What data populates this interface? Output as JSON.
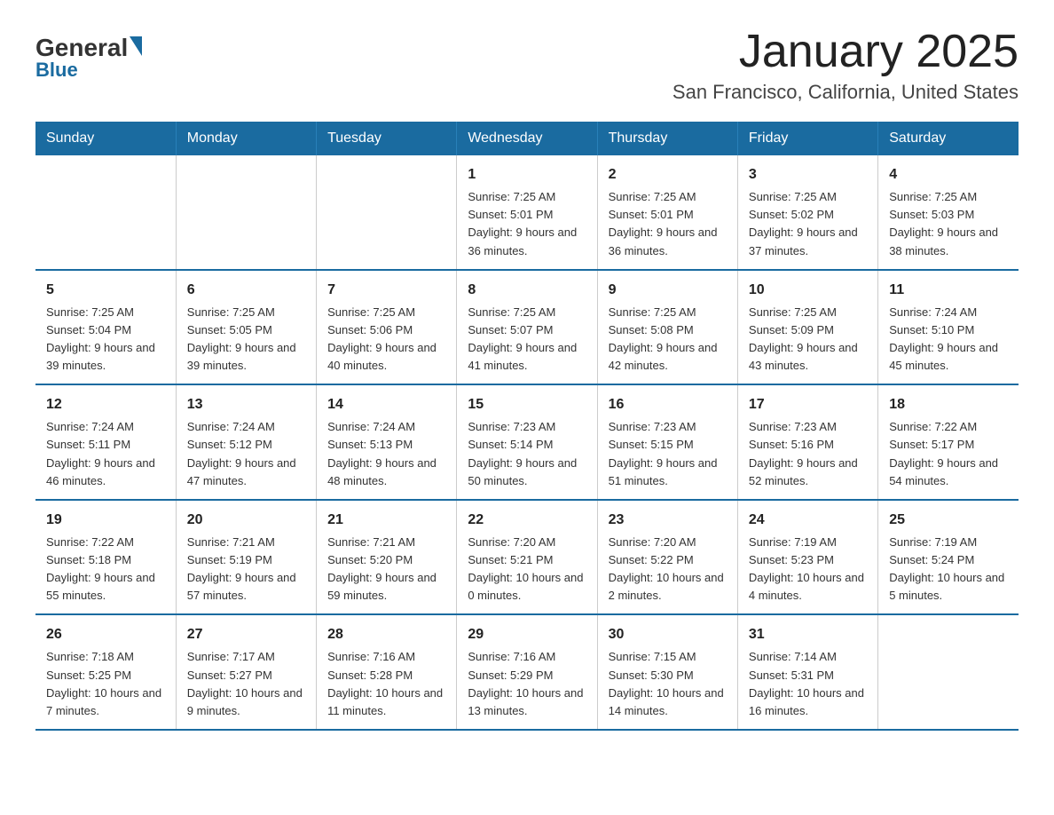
{
  "header": {
    "logo_general": "General",
    "logo_blue": "Blue",
    "month_title": "January 2025",
    "location": "San Francisco, California, United States"
  },
  "days_of_week": [
    "Sunday",
    "Monday",
    "Tuesday",
    "Wednesday",
    "Thursday",
    "Friday",
    "Saturday"
  ],
  "weeks": [
    [
      {
        "day": "",
        "sunrise": "",
        "sunset": "",
        "daylight": ""
      },
      {
        "day": "",
        "sunrise": "",
        "sunset": "",
        "daylight": ""
      },
      {
        "day": "",
        "sunrise": "",
        "sunset": "",
        "daylight": ""
      },
      {
        "day": "1",
        "sunrise": "Sunrise: 7:25 AM",
        "sunset": "Sunset: 5:01 PM",
        "daylight": "Daylight: 9 hours and 36 minutes."
      },
      {
        "day": "2",
        "sunrise": "Sunrise: 7:25 AM",
        "sunset": "Sunset: 5:01 PM",
        "daylight": "Daylight: 9 hours and 36 minutes."
      },
      {
        "day": "3",
        "sunrise": "Sunrise: 7:25 AM",
        "sunset": "Sunset: 5:02 PM",
        "daylight": "Daylight: 9 hours and 37 minutes."
      },
      {
        "day": "4",
        "sunrise": "Sunrise: 7:25 AM",
        "sunset": "Sunset: 5:03 PM",
        "daylight": "Daylight: 9 hours and 38 minutes."
      }
    ],
    [
      {
        "day": "5",
        "sunrise": "Sunrise: 7:25 AM",
        "sunset": "Sunset: 5:04 PM",
        "daylight": "Daylight: 9 hours and 39 minutes."
      },
      {
        "day": "6",
        "sunrise": "Sunrise: 7:25 AM",
        "sunset": "Sunset: 5:05 PM",
        "daylight": "Daylight: 9 hours and 39 minutes."
      },
      {
        "day": "7",
        "sunrise": "Sunrise: 7:25 AM",
        "sunset": "Sunset: 5:06 PM",
        "daylight": "Daylight: 9 hours and 40 minutes."
      },
      {
        "day": "8",
        "sunrise": "Sunrise: 7:25 AM",
        "sunset": "Sunset: 5:07 PM",
        "daylight": "Daylight: 9 hours and 41 minutes."
      },
      {
        "day": "9",
        "sunrise": "Sunrise: 7:25 AM",
        "sunset": "Sunset: 5:08 PM",
        "daylight": "Daylight: 9 hours and 42 minutes."
      },
      {
        "day": "10",
        "sunrise": "Sunrise: 7:25 AM",
        "sunset": "Sunset: 5:09 PM",
        "daylight": "Daylight: 9 hours and 43 minutes."
      },
      {
        "day": "11",
        "sunrise": "Sunrise: 7:24 AM",
        "sunset": "Sunset: 5:10 PM",
        "daylight": "Daylight: 9 hours and 45 minutes."
      }
    ],
    [
      {
        "day": "12",
        "sunrise": "Sunrise: 7:24 AM",
        "sunset": "Sunset: 5:11 PM",
        "daylight": "Daylight: 9 hours and 46 minutes."
      },
      {
        "day": "13",
        "sunrise": "Sunrise: 7:24 AM",
        "sunset": "Sunset: 5:12 PM",
        "daylight": "Daylight: 9 hours and 47 minutes."
      },
      {
        "day": "14",
        "sunrise": "Sunrise: 7:24 AM",
        "sunset": "Sunset: 5:13 PM",
        "daylight": "Daylight: 9 hours and 48 minutes."
      },
      {
        "day": "15",
        "sunrise": "Sunrise: 7:23 AM",
        "sunset": "Sunset: 5:14 PM",
        "daylight": "Daylight: 9 hours and 50 minutes."
      },
      {
        "day": "16",
        "sunrise": "Sunrise: 7:23 AM",
        "sunset": "Sunset: 5:15 PM",
        "daylight": "Daylight: 9 hours and 51 minutes."
      },
      {
        "day": "17",
        "sunrise": "Sunrise: 7:23 AM",
        "sunset": "Sunset: 5:16 PM",
        "daylight": "Daylight: 9 hours and 52 minutes."
      },
      {
        "day": "18",
        "sunrise": "Sunrise: 7:22 AM",
        "sunset": "Sunset: 5:17 PM",
        "daylight": "Daylight: 9 hours and 54 minutes."
      }
    ],
    [
      {
        "day": "19",
        "sunrise": "Sunrise: 7:22 AM",
        "sunset": "Sunset: 5:18 PM",
        "daylight": "Daylight: 9 hours and 55 minutes."
      },
      {
        "day": "20",
        "sunrise": "Sunrise: 7:21 AM",
        "sunset": "Sunset: 5:19 PM",
        "daylight": "Daylight: 9 hours and 57 minutes."
      },
      {
        "day": "21",
        "sunrise": "Sunrise: 7:21 AM",
        "sunset": "Sunset: 5:20 PM",
        "daylight": "Daylight: 9 hours and 59 minutes."
      },
      {
        "day": "22",
        "sunrise": "Sunrise: 7:20 AM",
        "sunset": "Sunset: 5:21 PM",
        "daylight": "Daylight: 10 hours and 0 minutes."
      },
      {
        "day": "23",
        "sunrise": "Sunrise: 7:20 AM",
        "sunset": "Sunset: 5:22 PM",
        "daylight": "Daylight: 10 hours and 2 minutes."
      },
      {
        "day": "24",
        "sunrise": "Sunrise: 7:19 AM",
        "sunset": "Sunset: 5:23 PM",
        "daylight": "Daylight: 10 hours and 4 minutes."
      },
      {
        "day": "25",
        "sunrise": "Sunrise: 7:19 AM",
        "sunset": "Sunset: 5:24 PM",
        "daylight": "Daylight: 10 hours and 5 minutes."
      }
    ],
    [
      {
        "day": "26",
        "sunrise": "Sunrise: 7:18 AM",
        "sunset": "Sunset: 5:25 PM",
        "daylight": "Daylight: 10 hours and 7 minutes."
      },
      {
        "day": "27",
        "sunrise": "Sunrise: 7:17 AM",
        "sunset": "Sunset: 5:27 PM",
        "daylight": "Daylight: 10 hours and 9 minutes."
      },
      {
        "day": "28",
        "sunrise": "Sunrise: 7:16 AM",
        "sunset": "Sunset: 5:28 PM",
        "daylight": "Daylight: 10 hours and 11 minutes."
      },
      {
        "day": "29",
        "sunrise": "Sunrise: 7:16 AM",
        "sunset": "Sunset: 5:29 PM",
        "daylight": "Daylight: 10 hours and 13 minutes."
      },
      {
        "day": "30",
        "sunrise": "Sunrise: 7:15 AM",
        "sunset": "Sunset: 5:30 PM",
        "daylight": "Daylight: 10 hours and 14 minutes."
      },
      {
        "day": "31",
        "sunrise": "Sunrise: 7:14 AM",
        "sunset": "Sunset: 5:31 PM",
        "daylight": "Daylight: 10 hours and 16 minutes."
      },
      {
        "day": "",
        "sunrise": "",
        "sunset": "",
        "daylight": ""
      }
    ]
  ]
}
